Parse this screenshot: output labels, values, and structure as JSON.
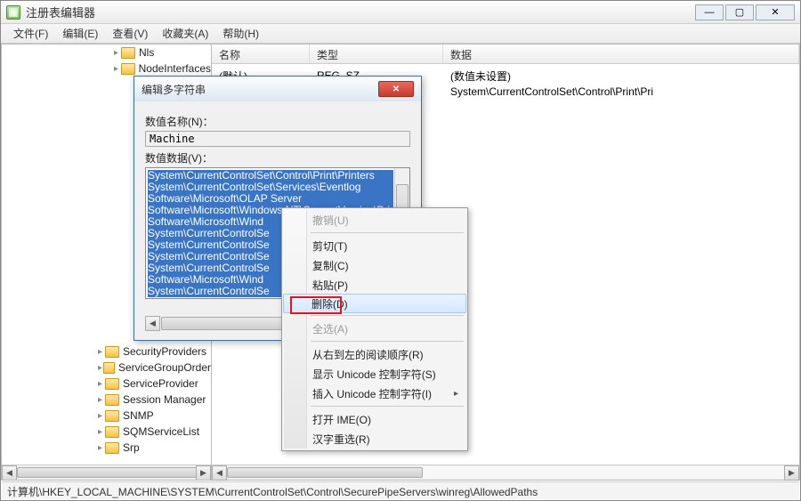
{
  "window": {
    "title": "注册表编辑器",
    "buttons": {
      "min": "—",
      "max": "▢",
      "close": "✕"
    }
  },
  "menu": {
    "file": "文件(F)",
    "edit": "编辑(E)",
    "view": "查看(V)",
    "favorites": "收藏夹(A)",
    "help": "帮助(H)"
  },
  "tree_top": [
    "Nls",
    "NodeInterfaces"
  ],
  "tree_bottom": [
    "SecurityProviders",
    "ServiceGroupOrder",
    "ServiceProvider",
    "Session Manager",
    "SNMP",
    "SQMServiceList",
    "Srp"
  ],
  "list": {
    "headers": {
      "name": "名称",
      "type": "类型",
      "data": "数据"
    },
    "col_widths": {
      "name": 110,
      "type": 150,
      "data": 400
    },
    "rows": [
      {
        "name": "(默认)",
        "type": "REG_SZ",
        "data": "(数值未设置)"
      },
      {
        "name": "",
        "type": "REG_MULTI_SZ",
        "data": "System\\CurrentControlSet\\Control\\Print\\Pri"
      }
    ]
  },
  "statusbar": "计算机\\HKEY_LOCAL_MACHINE\\SYSTEM\\CurrentControlSet\\Control\\SecurePipeServers\\winreg\\AllowedPaths",
  "dialog": {
    "title": "编辑多字符串",
    "name_label": "数值名称(N)：",
    "name_value": "Machine",
    "data_label": "数值数据(V)：",
    "lines": [
      "System\\CurrentControlSet\\Control\\Print\\Printers",
      "System\\CurrentControlSet\\Services\\Eventlog",
      "Software\\Microsoft\\OLAP Server",
      "Software\\Microsoft\\Windows NT\\CurrentVersion\\Print",
      "Software\\Microsoft\\Wind",
      "System\\CurrentControlSe",
      "System\\CurrentControlSe",
      "System\\CurrentControlSe",
      "System\\CurrentControlSe",
      "Software\\Microsoft\\Wind",
      "System\\CurrentControlSe"
    ]
  },
  "context_menu": {
    "undo": "撤销(U)",
    "cut": "剪切(T)",
    "copy": "复制(C)",
    "paste": "粘贴(P)",
    "delete": "删除(D)",
    "select_all": "全选(A)",
    "rtl": "从右到左的阅读顺序(R)",
    "show_unicode": "显示 Unicode 控制字符(S)",
    "insert_unicode": "插入 Unicode 控制字符(I)",
    "open_ime": "打开 IME(O)",
    "reconvert": "汉字重选(R)"
  },
  "icons": {
    "expand": "+",
    "collapse": "▸",
    "submenu": "▸",
    "scroll_left": "◀",
    "scroll_right": "▶",
    "caret": "▸"
  }
}
